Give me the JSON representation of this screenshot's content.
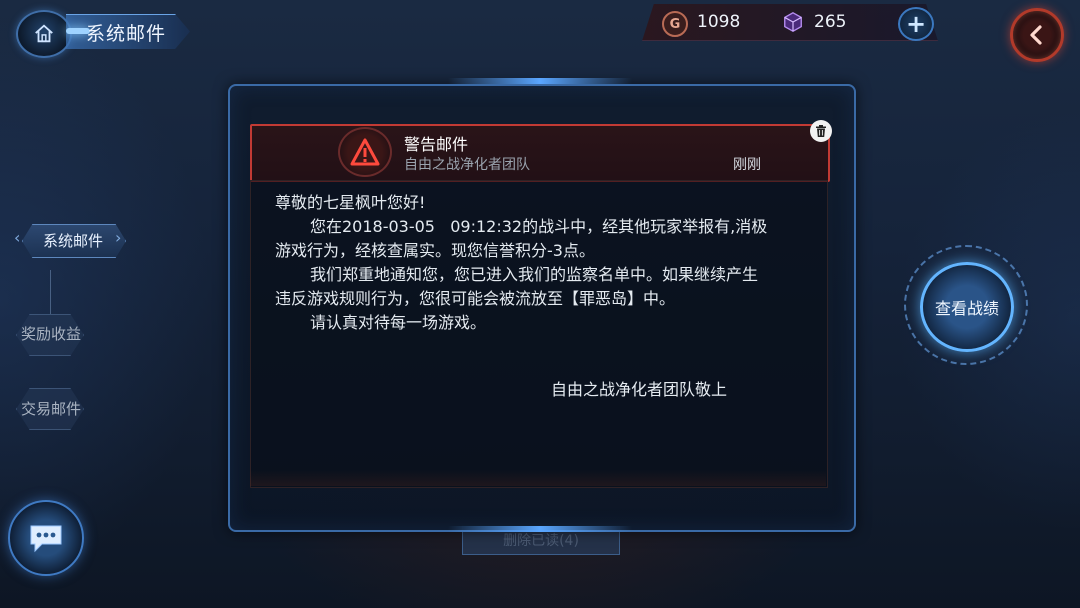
{
  "header": {
    "title": "系统邮件"
  },
  "currency": {
    "gold_symbol": "G",
    "gold": "1098",
    "gems": "265"
  },
  "sidebar": {
    "items": [
      {
        "label": "系统邮件",
        "active": true
      },
      {
        "label": "奖励收益",
        "active": false
      },
      {
        "label": "交易邮件",
        "active": false
      }
    ]
  },
  "right_panel": {
    "battle_button_label": "查看战绩"
  },
  "behind_button": {
    "label": "删除已读(4)"
  },
  "mail": {
    "title": "警告邮件",
    "sender": "自由之战净化者团队",
    "time": "刚刚",
    "body_lines": [
      "尊敬的七星枫叶您好!",
      "您在2018-03-05   09:12:32的战斗中，经其他玩家举报有,消极",
      "游戏行为，经核查属实。现您信誉积分-3点。",
      "我们郑重地通知您，您已进入我们的监察名单中。如果继续产生",
      "违反游戏规则行为，您很可能会被流放至【罪恶岛】中。",
      "请认真对待每一场游戏。"
    ],
    "signature": "自由之战净化者团队敬上"
  },
  "colors": {
    "accent_blue": "#5aa6ff",
    "warning_red": "#c23a34",
    "back_button_red": "#b23a2a"
  },
  "icons": [
    "home-icon",
    "gold-coin-icon",
    "gem-cube-icon",
    "plus-icon",
    "back-chevron-icon",
    "chat-bubble-icon",
    "warning-triangle-icon",
    "trash-icon"
  ]
}
